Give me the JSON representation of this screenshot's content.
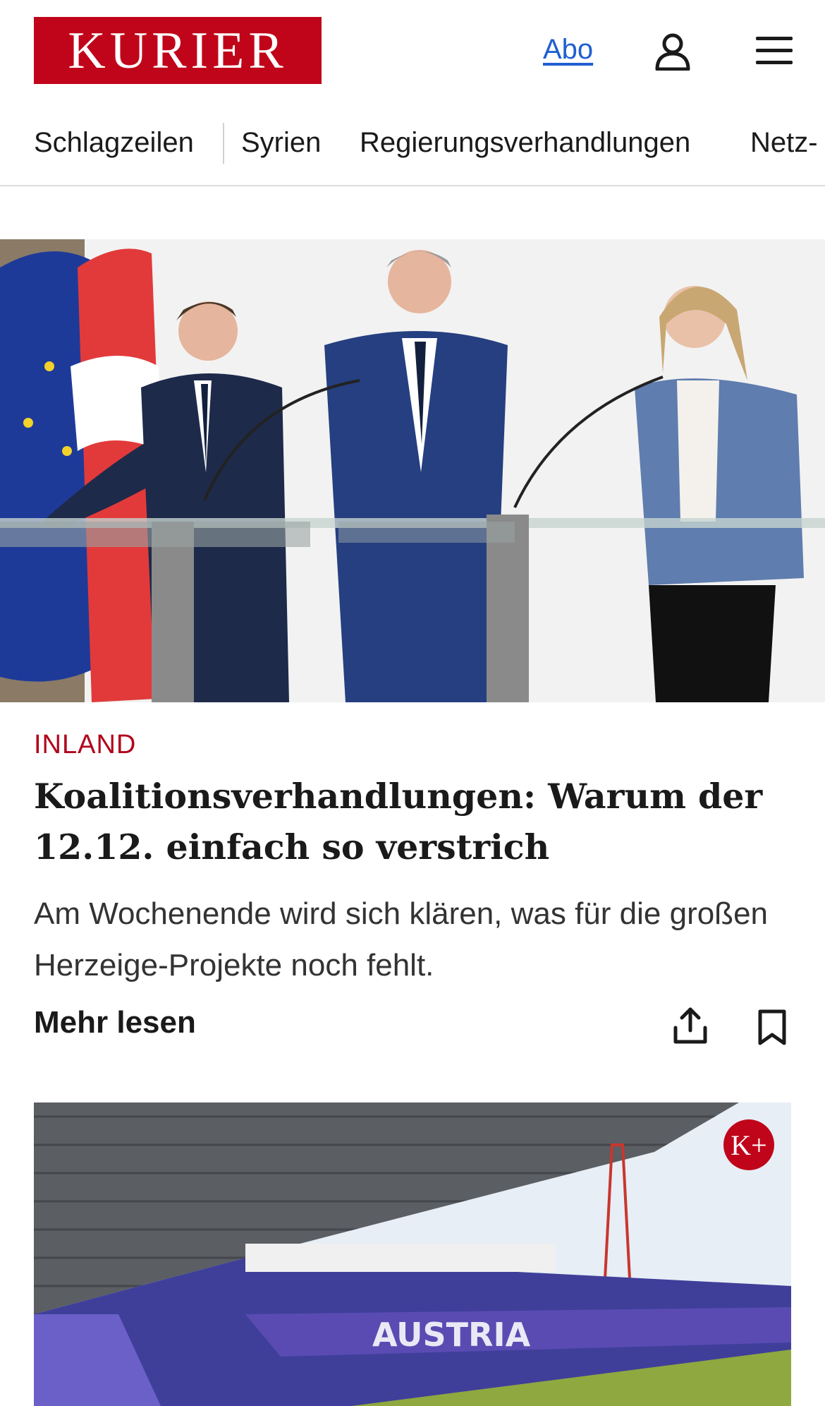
{
  "header": {
    "logo_text": "KURIER",
    "abo_label": "Abo",
    "icons": [
      "user-icon",
      "menu-icon"
    ]
  },
  "nav": {
    "items": [
      "Schlagzeilen",
      "Syrien",
      "Regierungsverhandlungen",
      "Netz-"
    ]
  },
  "article1": {
    "category": "INLAND",
    "headline": "Koalitionsverhandlungen: Warum der 12.12. einfach so verstrich",
    "teaser": "Am Wochenende wird sich klären, was für die großen Herzeige-Projekte noch fehlt.",
    "more_label": "Mehr lesen",
    "icons": [
      "share-icon",
      "bookmark-icon"
    ]
  },
  "article2": {
    "premium_badge": "K+"
  },
  "colors": {
    "brand_red": "#c0051a",
    "link_blue": "#1f5fd1",
    "category_red": "#b0061c"
  }
}
